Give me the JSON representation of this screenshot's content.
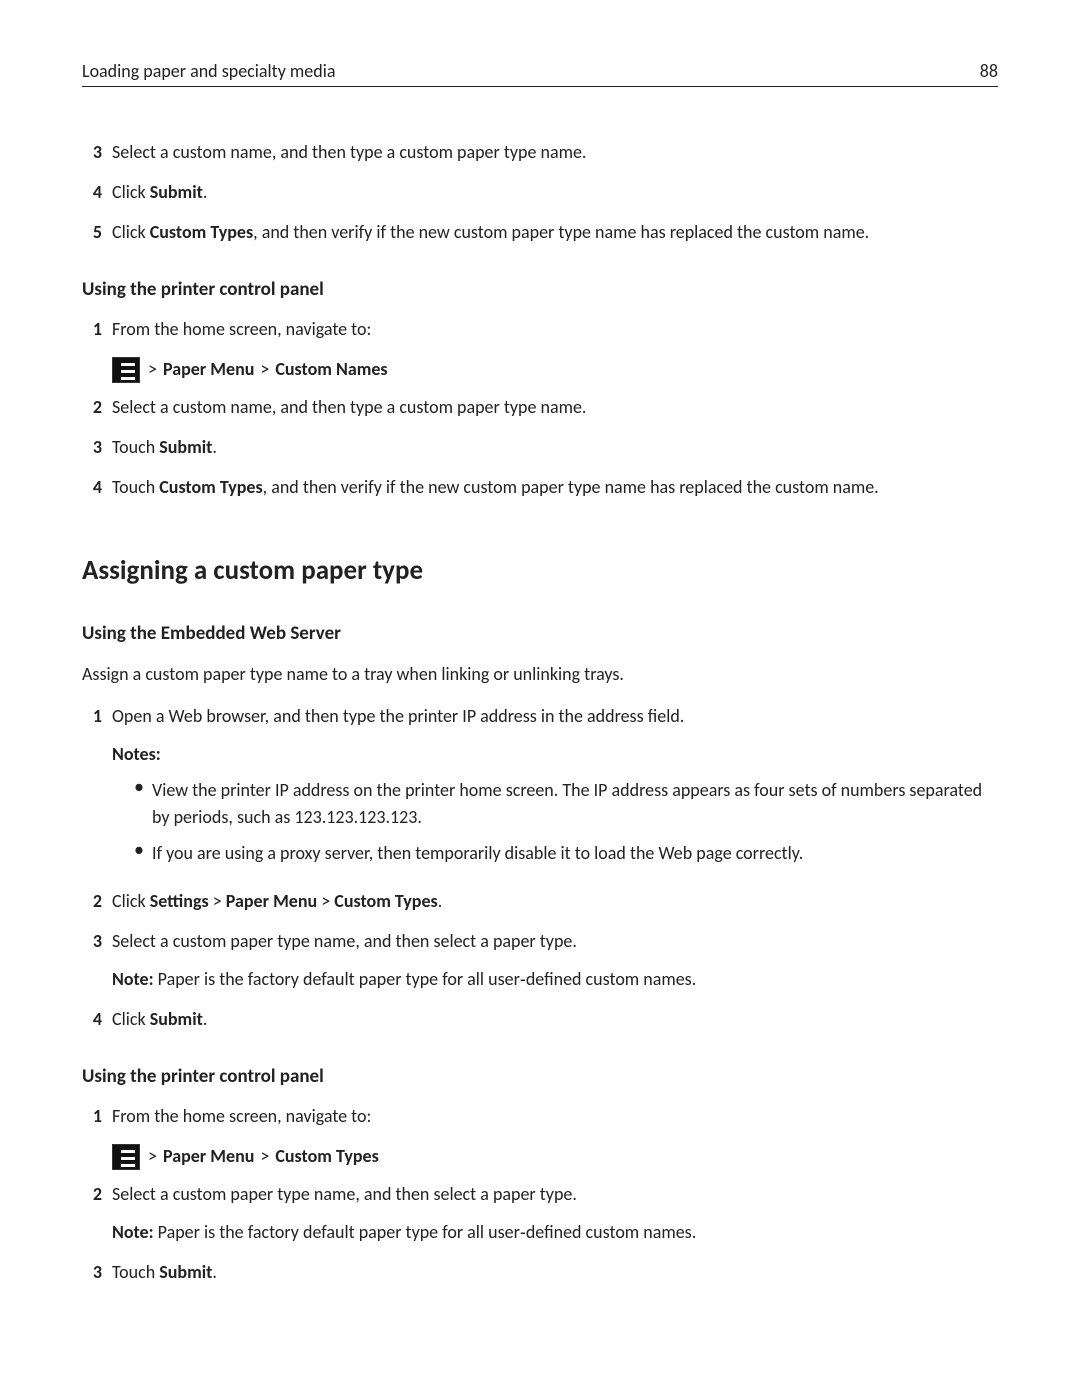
{
  "header": {
    "title": "Loading paper and specialty media",
    "page": "88"
  },
  "topList": {
    "items": [
      {
        "num": "3",
        "text": "Select a custom name, and then type a custom paper type name."
      },
      {
        "num": "4",
        "prefix": "Click ",
        "bold": "Submit",
        "suffix": "."
      },
      {
        "num": "5",
        "prefix": "Click ",
        "bold": "Custom Types",
        "suffix": ", and then verify if the new custom paper type name has replaced the custom name."
      }
    ]
  },
  "section1": {
    "heading": "Using the printer control panel",
    "items": [
      {
        "num": "1",
        "text": "From the home screen, navigate to:"
      },
      {
        "navPath": {
          "seg1": "Paper Menu",
          "seg2": "Custom Names"
        }
      },
      {
        "num": "2",
        "text": "Select a custom name, and then type a custom paper type name."
      },
      {
        "num": "3",
        "prefix": "Touch ",
        "bold": "Submit",
        "suffix": "."
      },
      {
        "num": "4",
        "prefix": "Touch ",
        "bold": "Custom Types",
        "suffix": ", and then verify if the new custom paper type name has replaced the custom name."
      }
    ]
  },
  "mainHeading": "Assigning a custom paper type",
  "section2": {
    "heading": "Using the Embedded Web Server",
    "intro": "Assign a custom paper type name to a tray when linking or unlinking trays.",
    "items": {
      "i1": {
        "num": "1",
        "text": "Open a Web browser, and then type the printer IP address in the address field."
      },
      "notesLabel": "Notes:",
      "bullets": [
        "View the printer IP address on the printer home screen. The IP address appears as four sets of numbers separated by periods, such as 123.123.123.123.",
        "If you are using a proxy server, then temporarily disable it to load the Web page correctly."
      ],
      "i2": {
        "num": "2",
        "prefix": "Click ",
        "b1": "Settings",
        "gt1": " > ",
        "b2": "Paper Menu",
        "gt2": " > ",
        "b3": "Custom Types",
        "suffix": "."
      },
      "i3": {
        "num": "3",
        "text": "Select a custom paper type name, and then select a paper type.",
        "noteLabel": "Note:",
        "noteText": " Paper is the factory default paper type for all user‑defined custom names."
      },
      "i4": {
        "num": "4",
        "prefix": "Click ",
        "bold": "Submit",
        "suffix": "."
      }
    }
  },
  "section3": {
    "heading": "Using the printer control panel",
    "items": {
      "i1": {
        "num": "1",
        "text": "From the home screen, navigate to:"
      },
      "navPath": {
        "seg1": "Paper Menu",
        "seg2": "Custom Types"
      },
      "i2": {
        "num": "2",
        "text": "Select a custom paper type name, and then select a paper type.",
        "noteLabel": "Note:",
        "noteText": " Paper is the factory default paper type for all user‑defined custom names."
      },
      "i3": {
        "num": "3",
        "prefix": "Touch ",
        "bold": "Submit",
        "suffix": "."
      }
    }
  }
}
